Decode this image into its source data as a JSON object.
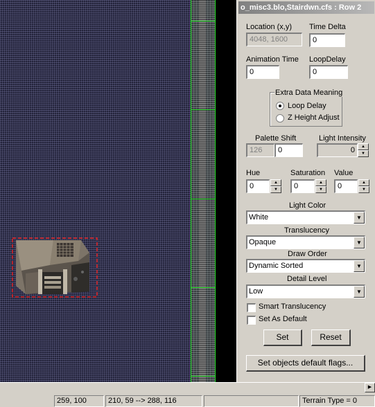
{
  "panel": {
    "title": "o_misc3.blo,Stairdwn.cfs : Row 2",
    "location_label": "Location (x,y)",
    "location_value": "4048, 1600",
    "time_delta_label": "Time Delta",
    "time_delta_value": "0",
    "animation_time_label": "Animation Time",
    "animation_time_value": "0",
    "loop_delay_label": "LoopDelay",
    "loop_delay_value": "0",
    "extra_data_label": "Extra Data Meaning",
    "radio_loop_delay": "Loop Delay",
    "radio_z_height": "Z Height Adjust",
    "palette_shift_label": "Palette Shift",
    "palette_shift_disabled": "126",
    "palette_shift_value": "0",
    "light_intensity_label": "Light Intensity",
    "light_intensity_value": "0",
    "hue_label": "Hue",
    "hue_value": "0",
    "saturation_label": "Saturation",
    "saturation_value": "0",
    "value_label": "Value",
    "value_value": "0",
    "light_color_label": "Light Color",
    "light_color_value": "White",
    "translucency_label": "Translucency",
    "translucency_value": "Opaque",
    "draw_order_label": "Draw Order",
    "draw_order_value": "Dynamic Sorted",
    "detail_level_label": "Detail Level",
    "detail_level_value": "Low",
    "smart_translucency_label": "Smart Translucency",
    "set_as_default_label": "Set As Default",
    "set_button": "Set",
    "reset_button": "Reset",
    "default_flags_button": "Set objects default flags..."
  },
  "status_bar": {
    "coords": "259,  100",
    "range": "210, 59 --> 288, 116",
    "terrain": "Terrain Type = 0"
  },
  "icons": {
    "dropdown": "chevron-down-icon",
    "spin_up": "arrow-up-icon",
    "spin_down": "arrow-down-icon",
    "scroll_right": "arrow-right-icon"
  },
  "colors": {
    "grid_guide": "#27e027",
    "selection": "#e02020",
    "panel_bg": "#d4d0c8"
  }
}
